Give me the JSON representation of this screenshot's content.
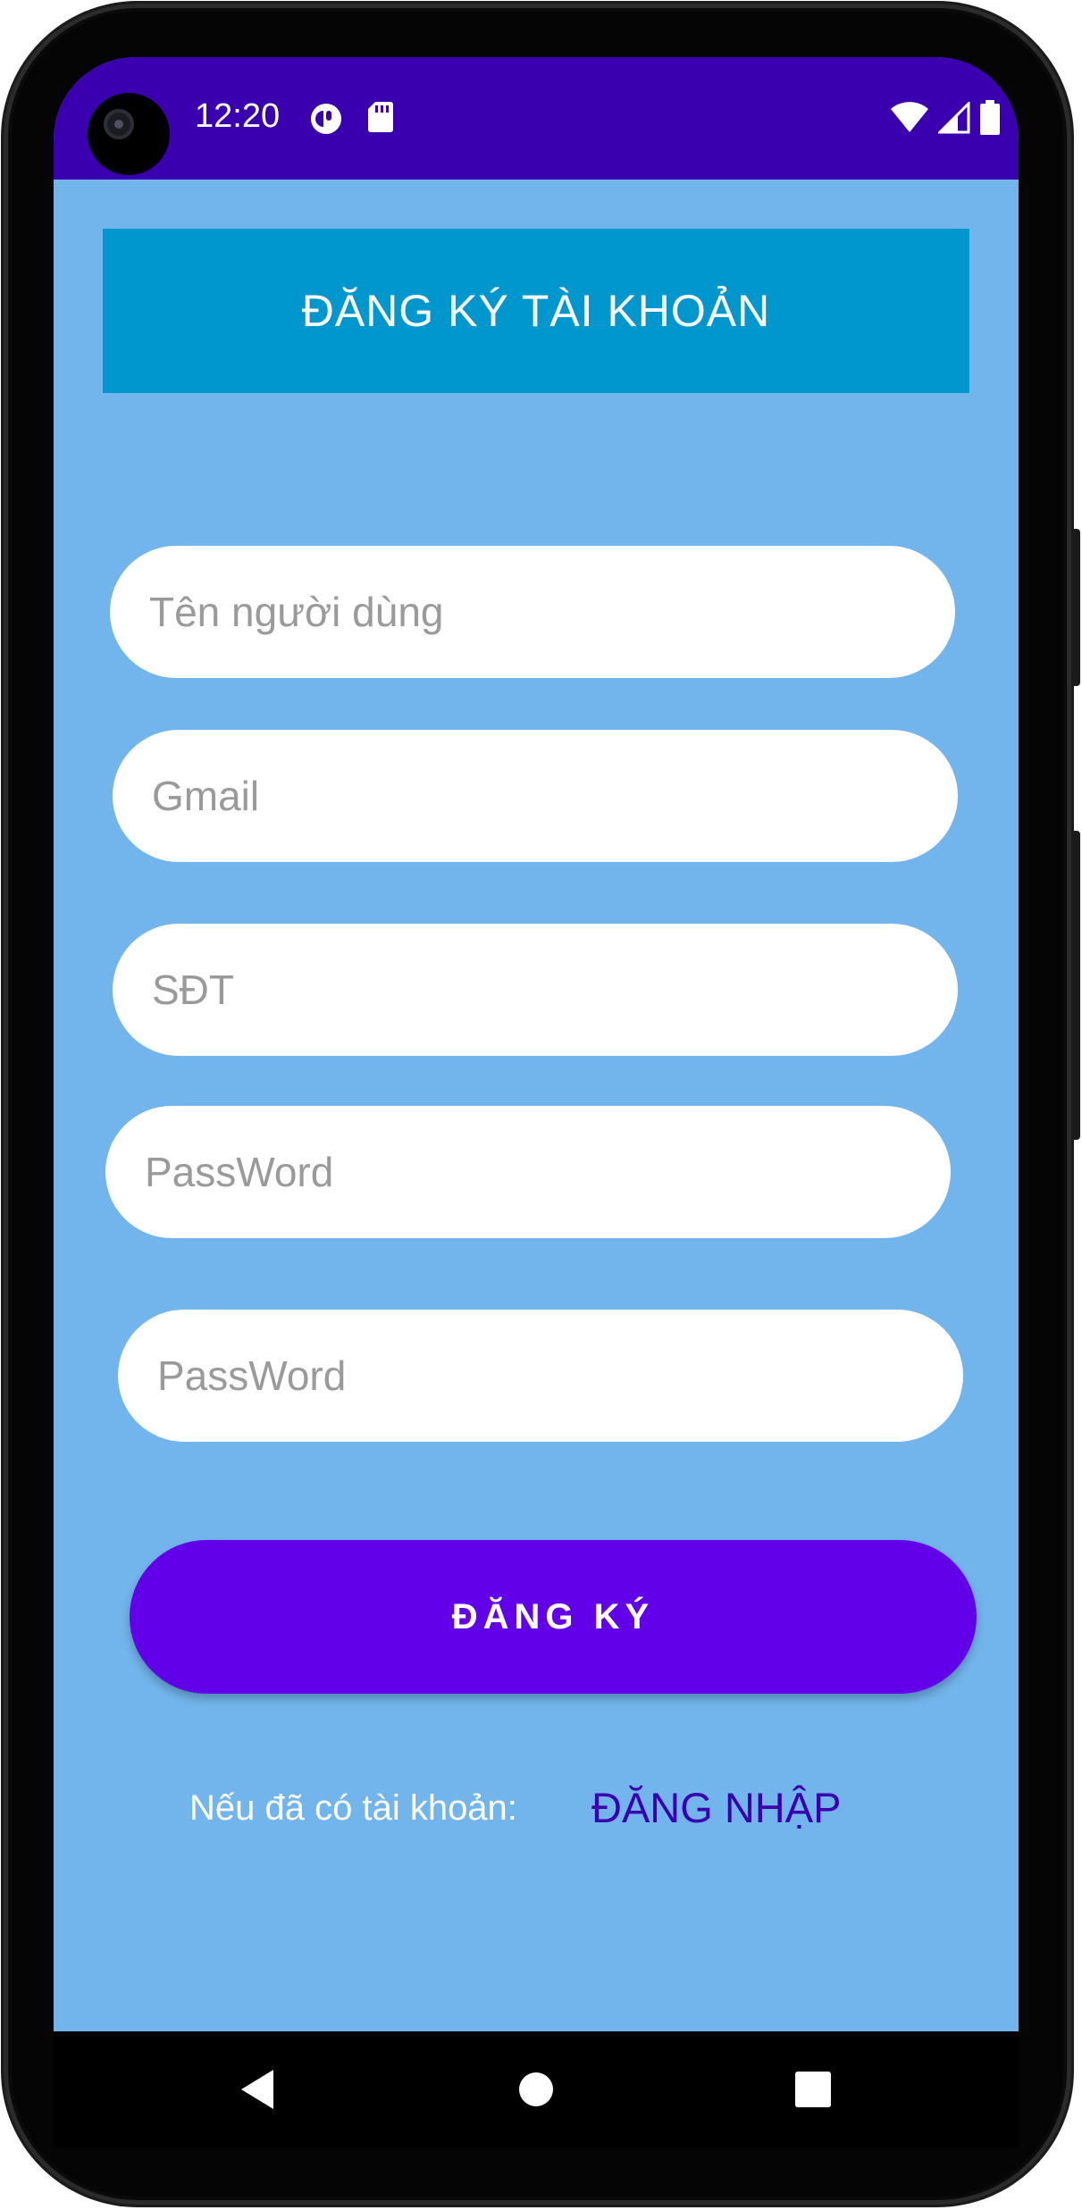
{
  "status_bar": {
    "time": "12:20"
  },
  "header": {
    "title": "ĐĂNG KÝ TÀI KHOẢN"
  },
  "form": {
    "fields": [
      {
        "placeholder": "Tên người dùng",
        "value": ""
      },
      {
        "placeholder": "Gmail",
        "value": ""
      },
      {
        "placeholder": "SĐT",
        "value": ""
      },
      {
        "placeholder": "PassWord",
        "value": ""
      },
      {
        "placeholder": "PassWord",
        "value": ""
      }
    ],
    "register_label": "ĐĂNG KÝ"
  },
  "footer": {
    "prompt": "Nếu đã có tài khoản:",
    "login_link": "ĐĂNG NHẬP"
  },
  "colors": {
    "status_bar": "#3a00b0",
    "background": "#72b5ec",
    "header": "#0097ce",
    "button": "#6200ea",
    "link": "#3a00b0"
  },
  "icons": {
    "status_left": [
      "notification-app-icon",
      "sd-card-icon"
    ],
    "status_right": [
      "wifi-icon",
      "cell-signal-icon",
      "battery-icon"
    ],
    "navigation": [
      "back-icon",
      "home-icon",
      "recents-icon"
    ]
  }
}
